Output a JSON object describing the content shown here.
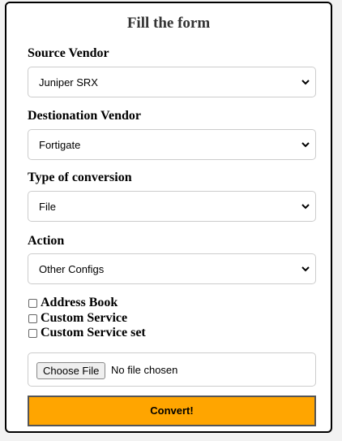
{
  "form": {
    "title": "Fill the form",
    "fields": [
      {
        "label": "Source Vendor",
        "value": "Juniper SRX"
      },
      {
        "label": "Destionation Vendor",
        "value": "Fortigate"
      },
      {
        "label": "Type of conversion",
        "value": "File"
      },
      {
        "label": "Action",
        "value": "Other Configs"
      }
    ],
    "checkboxes": [
      {
        "label": "Address Book",
        "checked": false
      },
      {
        "label": "Custom Service",
        "checked": false
      },
      {
        "label": "Custom Service set",
        "checked": false
      }
    ],
    "file_input": {
      "button_label": "Choose File",
      "status": "No file chosen"
    },
    "submit_label": "Convert!"
  },
  "colors": {
    "submit_bg": "#ffa500",
    "card_border": "#000000"
  }
}
